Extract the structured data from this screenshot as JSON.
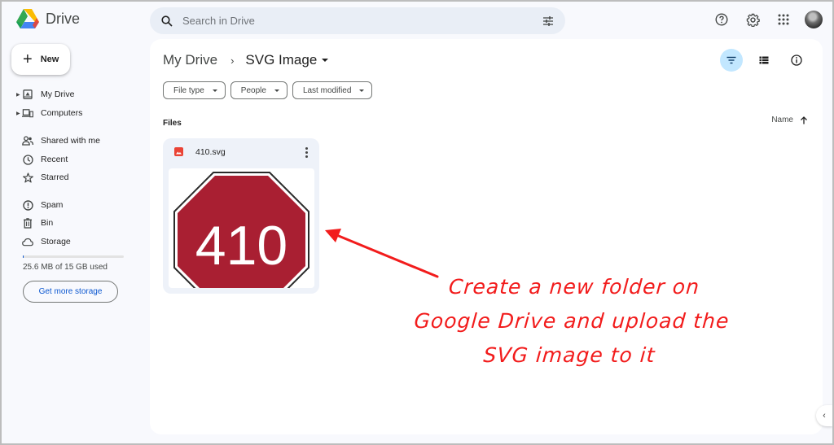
{
  "app": {
    "name": "Drive",
    "brand_colors": {
      "blue": "#4285f4",
      "green": "#34a853",
      "yellow": "#fbbc04",
      "red": "#ea4335"
    }
  },
  "search": {
    "placeholder": "Search in Drive",
    "value": ""
  },
  "topbar": {
    "icons": [
      "help-icon",
      "settings-icon",
      "apps-grid-icon",
      "account-avatar"
    ]
  },
  "sidebar": {
    "new_label": "New",
    "items": [
      {
        "label": "My Drive",
        "icon": "my-drive-icon",
        "expandable": true
      },
      {
        "label": "Computers",
        "icon": "computers-icon",
        "expandable": true
      },
      {
        "label": "Shared with me",
        "icon": "shared-icon",
        "expandable": false
      },
      {
        "label": "Recent",
        "icon": "clock-icon",
        "expandable": false
      },
      {
        "label": "Starred",
        "icon": "star-icon",
        "expandable": false
      },
      {
        "label": "Spam",
        "icon": "spam-icon",
        "expandable": false
      },
      {
        "label": "Bin",
        "icon": "trash-icon",
        "expandable": false
      },
      {
        "label": "Storage",
        "icon": "cloud-icon",
        "expandable": false
      }
    ],
    "storage": {
      "used_text": "25.6 MB of 15 GB used",
      "used_fraction": 0.0017,
      "button_label": "Get more storage"
    }
  },
  "main": {
    "breadcrumb": {
      "root": "My Drive",
      "separator": "›",
      "current": "SVG Image"
    },
    "filters": [
      {
        "label": "File type"
      },
      {
        "label": "People"
      },
      {
        "label": "Last modified"
      }
    ],
    "view_icons": [
      "filter-icon",
      "list-view-icon",
      "info-icon"
    ],
    "section_label": "Files",
    "sort": {
      "label": "Name",
      "direction": "ascending"
    },
    "files": [
      {
        "name": "410.svg",
        "type": "image",
        "thumbnail": {
          "text": "410",
          "fill": "#a91f32",
          "border": "#2b2b2b"
        }
      }
    ]
  },
  "annotation": {
    "lines": [
      "Create a new folder on",
      "Google Drive and upload the",
      "SVG image to it"
    ],
    "color": "#f21c1c"
  }
}
